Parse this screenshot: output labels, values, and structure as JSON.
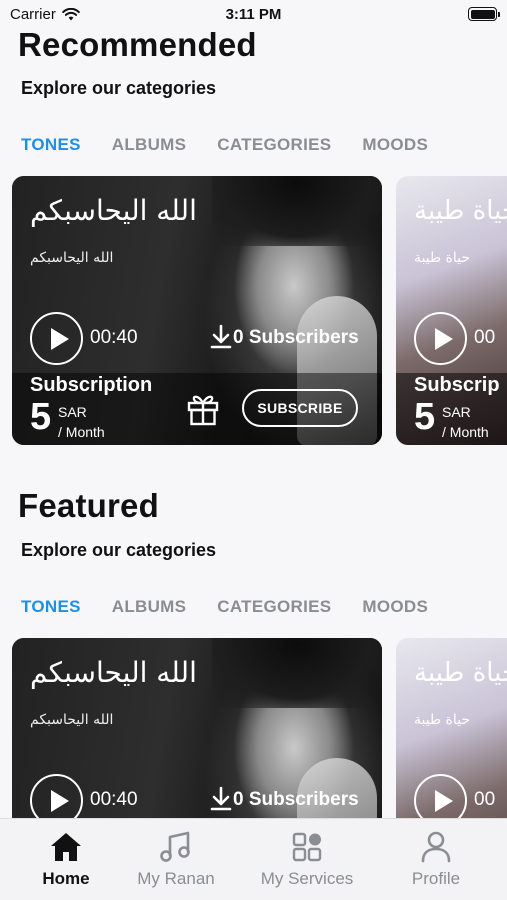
{
  "status_bar": {
    "carrier": "Carrier",
    "time": "3:11 PM"
  },
  "sections": [
    {
      "title": "Recommended",
      "subtitle": "Explore our categories",
      "tabs": [
        "TONES",
        "ALBUMS",
        "CATEGORIES",
        "MOODS"
      ],
      "active_tab": "TONES",
      "card": {
        "title": "الله اليحاسبكم",
        "subtitle": "الله اليحاسبكم",
        "duration": "00:40",
        "subscribers": "0 Subscribers",
        "subscription_label": "Subscription",
        "price": "5",
        "currency": "SAR",
        "period": "/ Month",
        "subscribe_label": "SUBSCRIBE"
      },
      "next_card": {
        "title": "حياة طيبة",
        "subtitle": "حياة طيبة",
        "duration": "00",
        "subscription_label": "Subscrip",
        "price": "5",
        "currency": "SAR",
        "period": "/ Month"
      }
    },
    {
      "title": "Featured",
      "subtitle": "Explore our categories",
      "tabs": [
        "TONES",
        "ALBUMS",
        "CATEGORIES",
        "MOODS"
      ],
      "active_tab": "TONES",
      "card": {
        "title": "الله اليحاسبكم",
        "subtitle": "الله اليحاسبكم",
        "duration": "00:40",
        "subscribers": "0 Subscribers"
      },
      "next_card": {
        "title": "حياة طيبة",
        "subtitle": "حياة طيبة",
        "duration": "00"
      }
    }
  ],
  "tab_bar": {
    "items": [
      {
        "label": "Home",
        "icon": "home-icon",
        "active": true
      },
      {
        "label": "My Ranan",
        "icon": "music-note-icon",
        "active": false
      },
      {
        "label": "My Services",
        "icon": "grid-icon",
        "active": false
      },
      {
        "label": "Profile",
        "icon": "person-icon",
        "active": false
      }
    ]
  },
  "colors": {
    "accent": "#1e8fe3",
    "inactive": "#8a8d93",
    "background": "#f7f7f9"
  }
}
